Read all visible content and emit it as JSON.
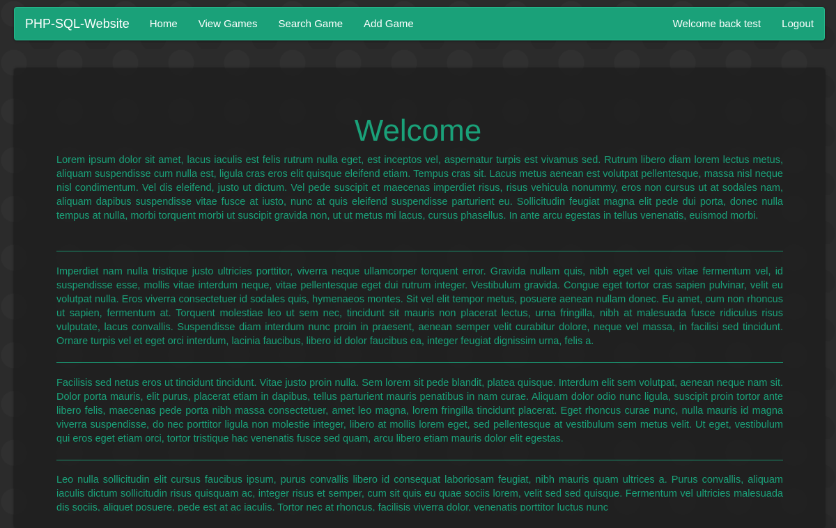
{
  "navbar": {
    "brand": "PHP-SQL-Website",
    "links": [
      {
        "label": "Home"
      },
      {
        "label": "View Games"
      },
      {
        "label": "Search Game"
      },
      {
        "label": "Add Game"
      }
    ],
    "welcome_text": "Welcome back test",
    "logout_label": "Logout"
  },
  "colors": {
    "accent": "#1aa179",
    "background": "#2b2b2b",
    "panel": "#1e1e1e"
  },
  "main": {
    "title": "Welcome",
    "paragraphs": [
      "Lorem ipsum dolor sit amet, lacus iaculis est felis rutrum nulla eget, est inceptos vel, aspernatur turpis est vivamus sed. Rutrum libero diam lorem lectus metus, aliquam suspendisse cum nulla est, ligula cras eros elit quisque eleifend etiam. Tempus cras sit. Lacus metus aenean est volutpat pellentesque, massa nisl neque nisl condimentum. Vel dis eleifend, justo ut dictum. Vel pede suscipit et maecenas imperdiet risus, risus vehicula nonummy, eros non cursus ut at sodales nam, aliquam dapibus suspendisse vitae fusce at iusto, nunc at quis eleifend suspendisse parturient eu. Sollicitudin feugiat magna elit pede dui porta, donec nulla tempus at nulla, morbi torquent morbi ut suscipit gravida non, ut ut metus mi lacus, cursus phasellus. In ante arcu egestas in tellus venenatis, euismod morbi.",
      "Imperdiet nam nulla tristique justo ultricies porttitor, viverra neque ullamcorper torquent error. Gravida nullam quis, nibh eget vel quis vitae fermentum vel, id suspendisse esse, mollis vitae interdum neque, vitae pellentesque eget dui rutrum integer. Vestibulum gravida. Congue eget tortor cras sapien pulvinar, velit eu volutpat nulla. Eros viverra consectetuer id sodales quis, hymenaeos montes. Sit vel elit tempor metus, posuere aenean nullam donec. Eu amet, cum non rhoncus ut sapien, fermentum at. Torquent molestiae leo ut sem nec, tincidunt sit mauris non placerat lectus, urna fringilla, nibh at malesuada fusce ridiculus risus vulputate, lacus convallis. Suspendisse diam interdum nunc proin in praesent, aenean semper velit curabitur dolore, neque vel massa, in facilisi sed tincidunt. Ornare turpis vel et eget orci interdum, lacinia faucibus, libero id dolor faucibus ea, integer feugiat dignissim urna, felis a.",
      "Facilisis sed netus eros ut tincidunt tincidunt. Vitae justo proin nulla. Sem lorem sit pede blandit, platea quisque. Interdum elit sem volutpat, aenean neque nam sit. Dolor porta mauris, elit purus, placerat etiam in dapibus, tellus parturient mauris penatibus in nam curae. Aliquam dolor odio nunc ligula, suscipit proin tortor ante libero felis, maecenas pede porta nibh massa consectetuer, amet leo magna, lorem fringilla tincidunt placerat. Eget rhoncus curae nunc, nulla mauris id magna viverra suspendisse, do nec porttitor ligula non molestie integer, libero at mollis lorem eget, sed pellentesque at vestibulum sem metus velit. Ut eget, vestibulum qui eros eget etiam orci, tortor tristique hac venenatis fusce sed quam, arcu libero etiam mauris dolor elit egestas.",
      "Leo nulla sollicitudin elit cursus faucibus ipsum, purus convallis libero id consequat laboriosam feugiat, nibh mauris quam ultrices a. Purus convallis, aliquam iaculis dictum sollicitudin risus quisquam ac, integer risus et semper, cum sit quis eu quae sociis lorem, velit sed sed quisque. Fermentum vel ultricies malesuada dis sociis, aliquet posuere, pede est at ac iaculis. Tortor nec at rhoncus, facilisis viverra dolor, venenatis porttitor luctus nunc"
    ]
  }
}
